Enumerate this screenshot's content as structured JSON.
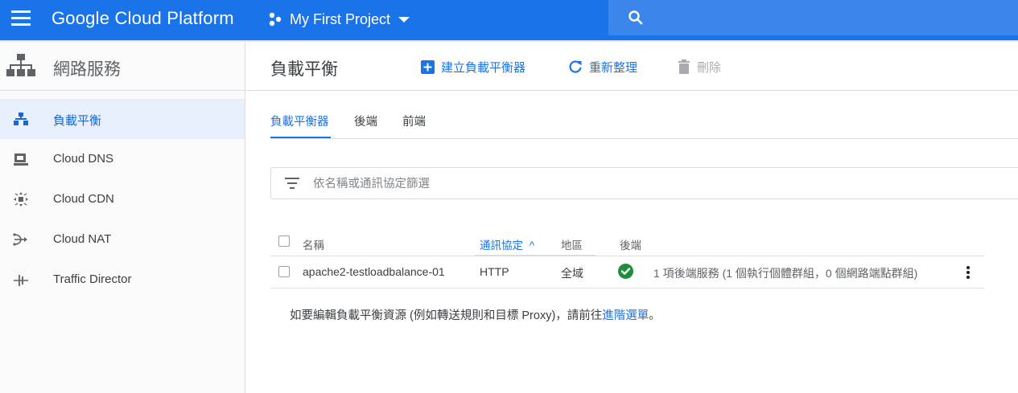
{
  "header": {
    "brand": "Google Cloud Platform",
    "project": "My First Project",
    "search_placeholder": ""
  },
  "sidebar": {
    "title": "網路服務",
    "items": [
      {
        "label": "負載平衡",
        "icon": "load-balancing-icon",
        "active": true
      },
      {
        "label": "Cloud DNS",
        "icon": "cloud-dns-icon"
      },
      {
        "label": "Cloud CDN",
        "icon": "cloud-cdn-icon"
      },
      {
        "label": "Cloud NAT",
        "icon": "cloud-nat-icon"
      },
      {
        "label": "Traffic Director",
        "icon": "traffic-director-icon"
      }
    ]
  },
  "main": {
    "title": "負載平衡",
    "actions": {
      "create": "建立負載平衡器",
      "refresh": "重新整理",
      "delete": "刪除"
    },
    "tabs": [
      {
        "label": "負載平衡器",
        "active": true
      },
      {
        "label": "後端"
      },
      {
        "label": "前端"
      }
    ],
    "filter_placeholder": "依名稱或通訊協定篩選",
    "table": {
      "headers": {
        "name": "名稱",
        "protocol": "通訊協定",
        "sort_indicator": "^",
        "region": "地區",
        "backends": "後端"
      },
      "rows": [
        {
          "name": "apache2-testloadbalance-01",
          "protocol": "HTTP",
          "region": "全域",
          "status": "ok",
          "backends": "1 項後端服務 (1 個執行個體群組，0 個網路端點群組)"
        }
      ]
    },
    "note": {
      "text": "如要編輯負載平衡資源 (例如轉送規則和目標 Proxy)，請前往",
      "link": "進階選單",
      "suffix": "。"
    }
  },
  "colors": {
    "topbar": "#1a73e8",
    "accent": "#1a73e8",
    "status_ok": "#1e8e3e",
    "sidebar_active_bg": "#e8f0fe"
  }
}
